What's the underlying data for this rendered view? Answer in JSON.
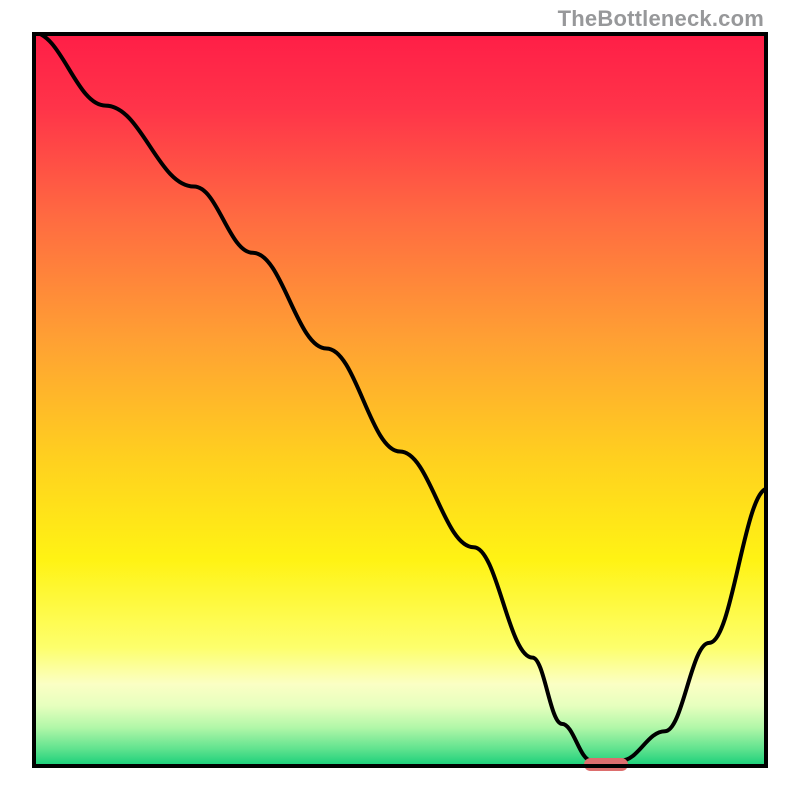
{
  "attribution": "TheBottleneck.com",
  "colors": {
    "frame": "#000000",
    "marker": "#dd6e6e",
    "curve": "#000000",
    "gradient_stops": [
      {
        "pos": 0.0,
        "color": "#ff1f47"
      },
      {
        "pos": 0.1,
        "color": "#ff3449"
      },
      {
        "pos": 0.25,
        "color": "#ff6b41"
      },
      {
        "pos": 0.42,
        "color": "#ffa133"
      },
      {
        "pos": 0.58,
        "color": "#ffd01f"
      },
      {
        "pos": 0.72,
        "color": "#fff314"
      },
      {
        "pos": 0.84,
        "color": "#fdff6c"
      },
      {
        "pos": 0.89,
        "color": "#fbffc4"
      },
      {
        "pos": 0.92,
        "color": "#e6ffbe"
      },
      {
        "pos": 0.95,
        "color": "#b1f7a8"
      },
      {
        "pos": 0.98,
        "color": "#5ee28e"
      },
      {
        "pos": 1.0,
        "color": "#1fd17b"
      }
    ]
  },
  "chart_data": {
    "type": "line",
    "title": "",
    "xlabel": "",
    "ylabel": "",
    "xlim": [
      0,
      100
    ],
    "ylim": [
      0,
      100
    ],
    "x": [
      0,
      10,
      22,
      30,
      40,
      50,
      60,
      68,
      72,
      76,
      80,
      86,
      92,
      100
    ],
    "y": [
      100,
      90,
      79,
      70,
      57,
      43,
      30,
      15,
      6,
      1,
      1,
      5,
      17,
      38
    ],
    "marker": {
      "x": 78,
      "y": 0.5,
      "width": 6,
      "height": 1.8
    },
    "note": "x and y are in percent of inner plot area; y=0 at bottom axis, y=100 at top axis."
  }
}
